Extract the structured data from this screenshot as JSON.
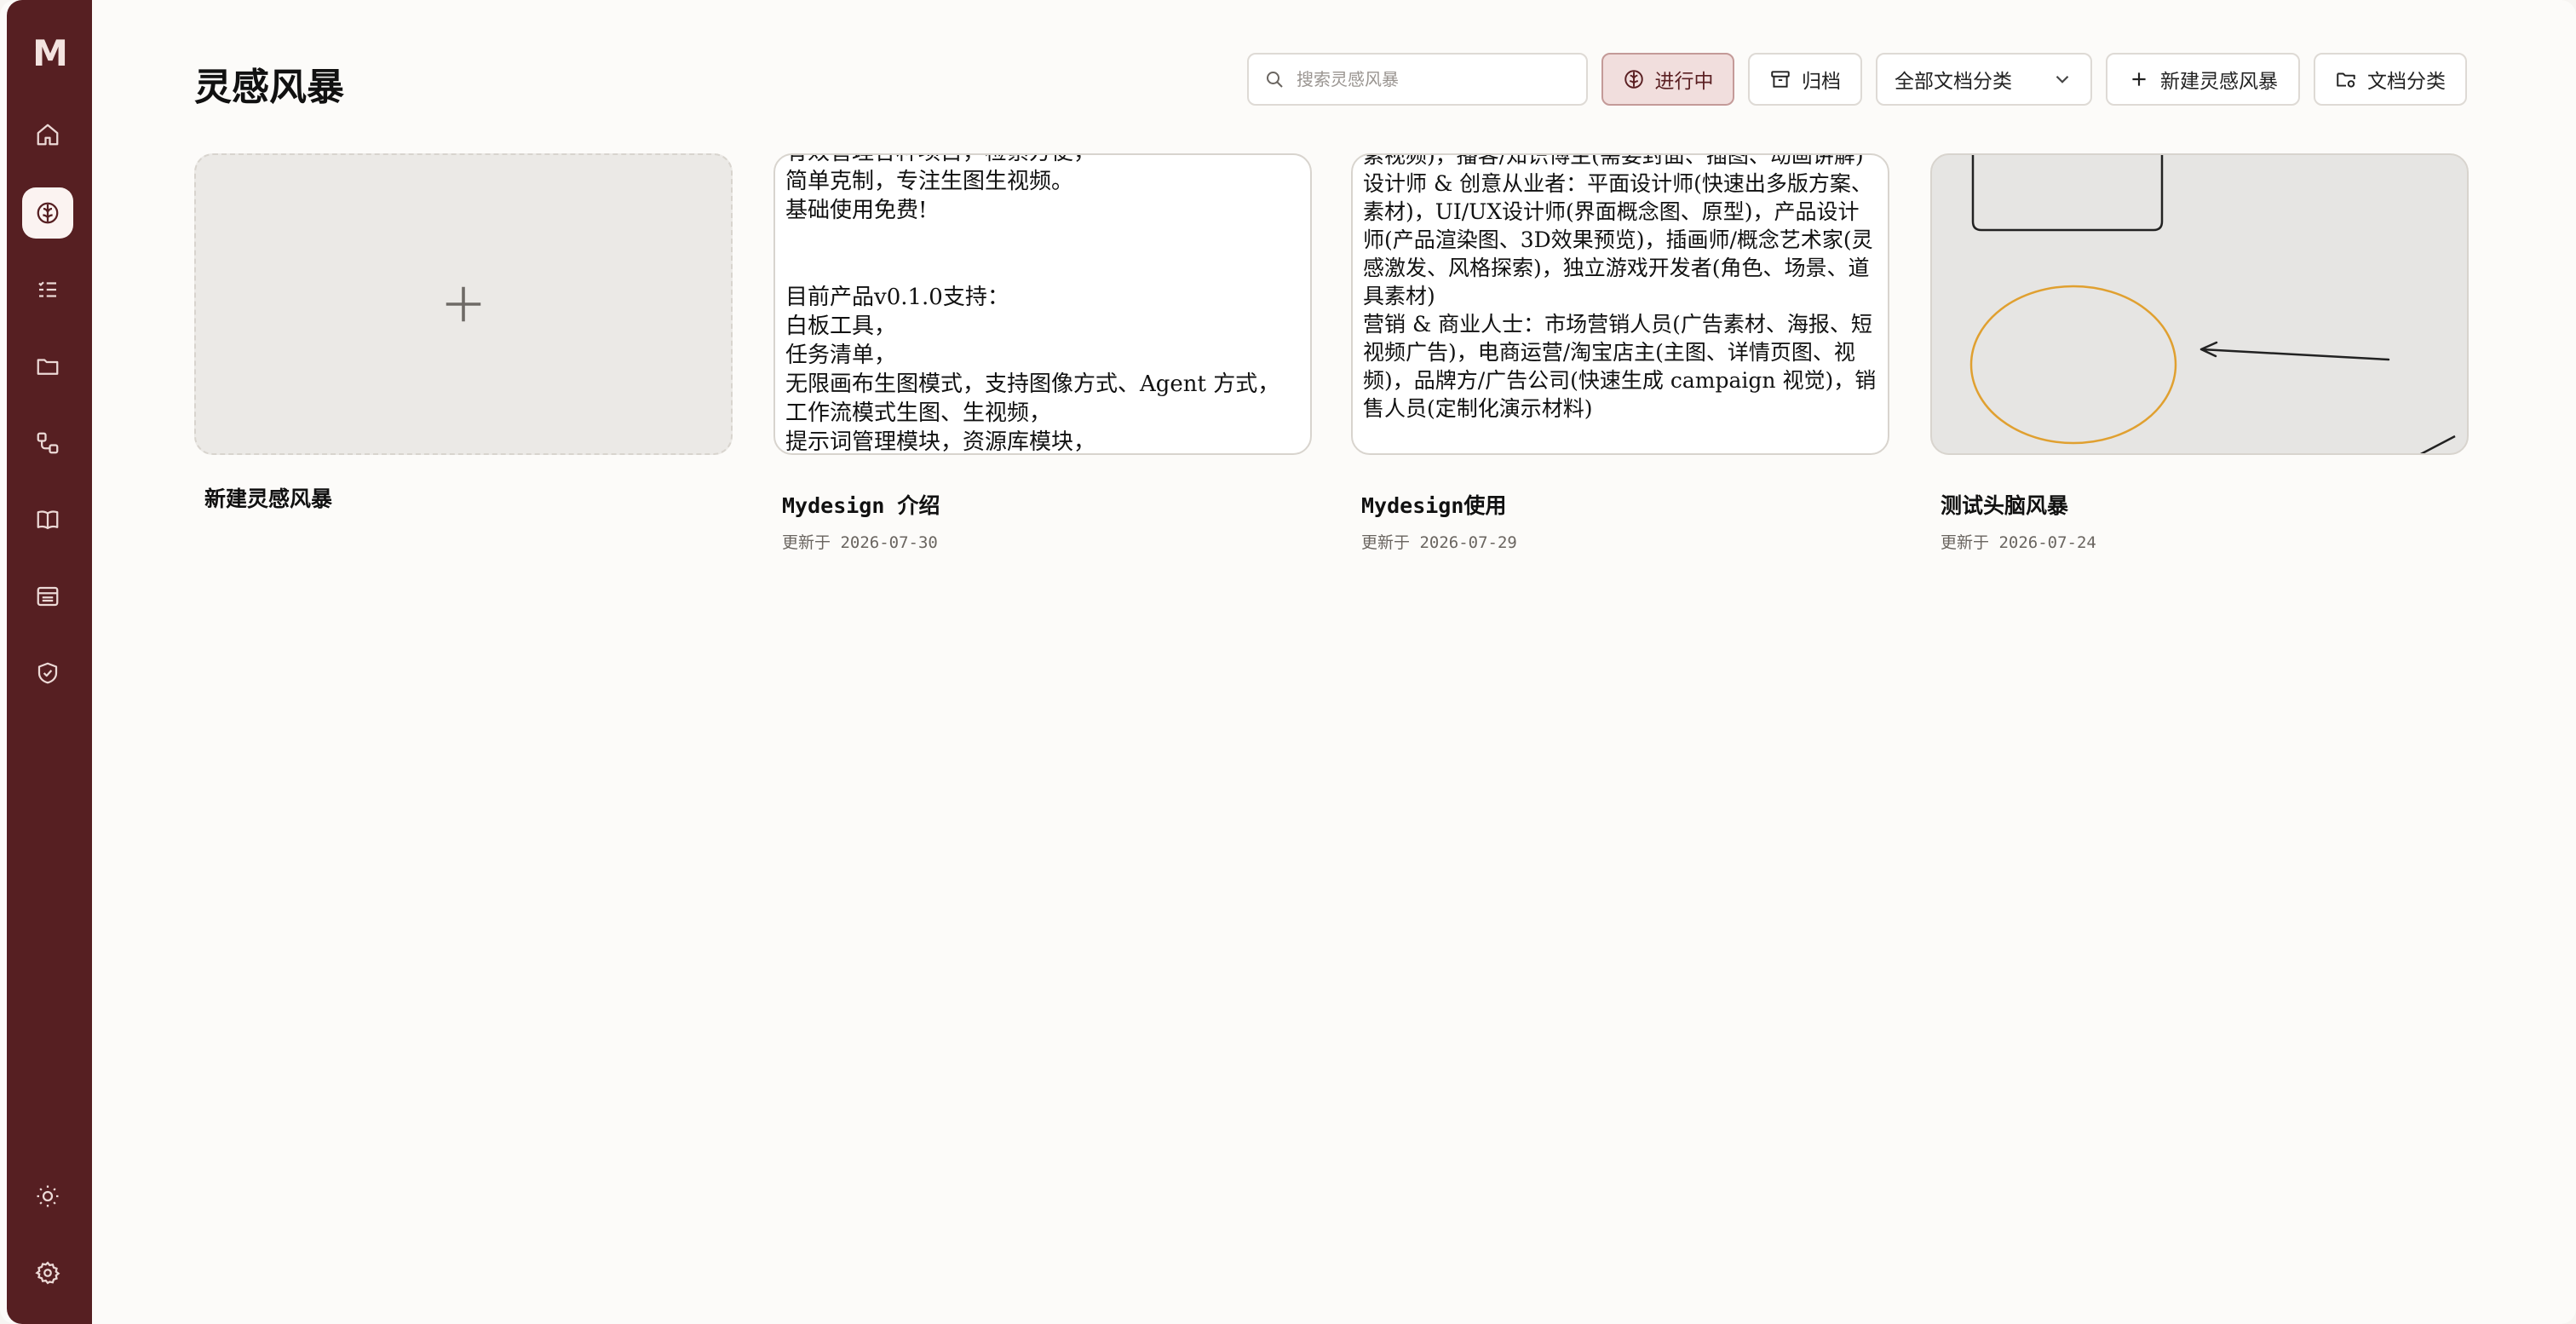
{
  "app": {
    "logo": "M",
    "page_title": "灵感风暴"
  },
  "sidebar": {
    "items": [
      {
        "name": "home-icon"
      },
      {
        "name": "brain-icon",
        "active": true
      },
      {
        "name": "task-list-icon"
      },
      {
        "name": "folder-icon"
      },
      {
        "name": "workflow-icon"
      },
      {
        "name": "book-icon"
      },
      {
        "name": "archive-box-icon"
      },
      {
        "name": "shield-check-icon"
      },
      {
        "name": "sun-icon"
      },
      {
        "name": "gear-icon"
      }
    ]
  },
  "toolbar": {
    "search_placeholder": "搜索灵感风暴",
    "in_progress_label": "进行中",
    "archive_label": "归档",
    "category_select_value": "全部文档分类",
    "new_label": "新建灵感风暴",
    "doc_category_label": "文档分类"
  },
  "cards": [
    {
      "title": "新建灵感风暴",
      "date": ""
    },
    {
      "title": "Mydesign 介绍",
      "date": "更新于 2026-07-30",
      "preview": "有效管理各种项目，检索方便，\n简单克制，专注生图生视频。\n基础使用免费!\n\n\n目前产品v0.1.0支持：\n白板工具，\n任务清单，\n无限画布生图模式，支持图像方式、Agent 方式，\n工作流模式生图、生视频，\n提示词管理模块，资源库模块，"
    },
    {
      "title": "Mydesign使用",
      "date": "更新于 2026-07-29",
      "preview": "素视频)，播客/知识博主(需要封面、插图、动画讲解)\n设计师 & 创意从业者：平面设计师(快速出多版方案、素材)，UI/UX设计师(界面概念图、原型)，产品设计师(产品渲染图、3D效果预览)，插画师/概念艺术家(灵感激发、风格探索)，独立游戏开发者(角色、场景、道具素材)\n营销 & 商业人士：市场营销人员(广告素材、海报、短视频广告)，电商运营/淘宝店主(主图、详情页图、视频)，品牌方/广告公司(快速生成 campaign 视觉)，销售人员(定制化演示材料)"
    },
    {
      "title": "测试头脑风暴",
      "date": "更新于 2026-07-24"
    }
  ],
  "colors": {
    "sidebar": "#561f22",
    "accent_active": "#f1dedd",
    "sketch_orange": "#e0a030"
  }
}
